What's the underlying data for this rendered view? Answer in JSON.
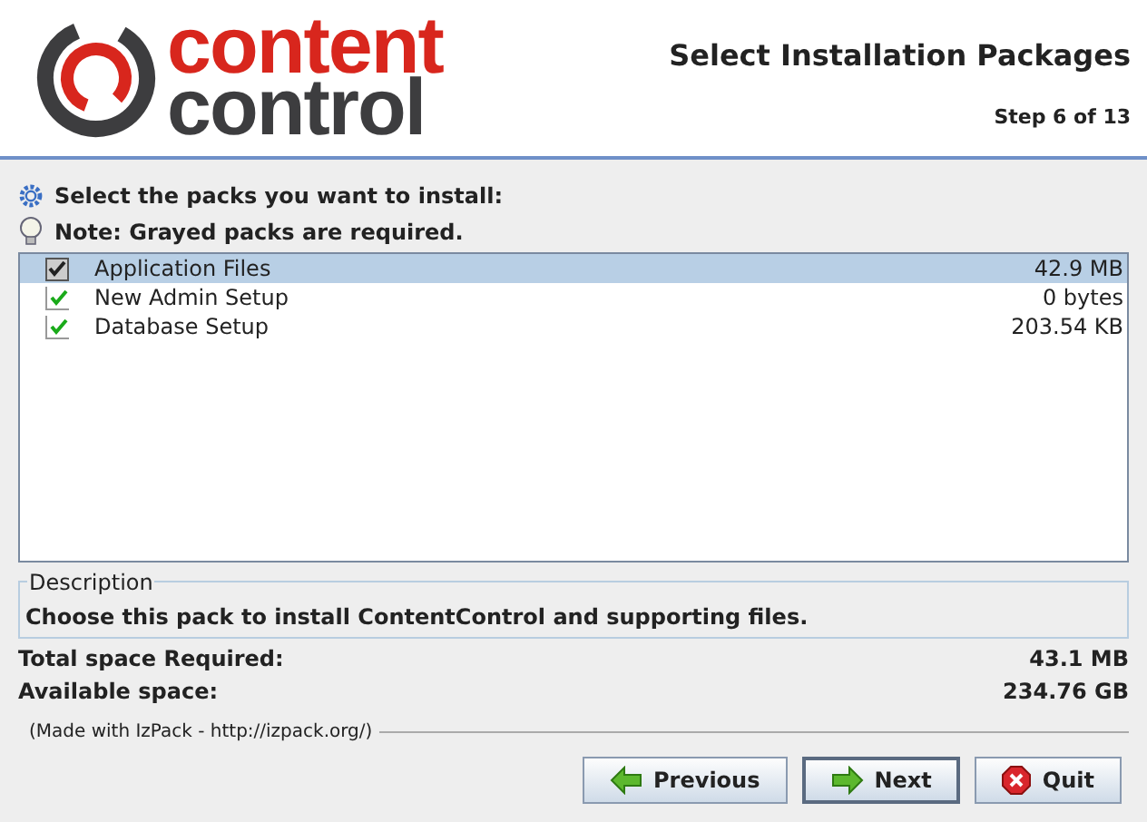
{
  "logo": {
    "line_1": "content",
    "line_2": "control"
  },
  "header": {
    "title": "Select Installation Packages",
    "step": "Step 6 of 13"
  },
  "instructions": [
    {
      "kind": "gear",
      "text": "Select the packs you want to install:"
    },
    {
      "kind": "bulb",
      "text": "Note: Grayed packs are required."
    }
  ],
  "packs": [
    {
      "name": "Application Files",
      "size": "42.9 MB",
      "checked": true,
      "disabled": true,
      "selected": true
    },
    {
      "name": "New Admin Setup",
      "size": "0 bytes",
      "checked": true,
      "disabled": false,
      "selected": false
    },
    {
      "name": "Database Setup",
      "size": "203.54 KB",
      "checked": true,
      "disabled": false,
      "selected": false
    }
  ],
  "description": {
    "legend": "Description",
    "text": "Choose this pack to install ContentControl and supporting files."
  },
  "space": [
    {
      "label": "Total space Required:",
      "value": "43.1 MB"
    },
    {
      "label": "Available space:",
      "value": "234.76 GB"
    }
  ],
  "footer_note": "(Made with IzPack - http://izpack.org/)",
  "buttons": [
    {
      "kind": "previous",
      "label": "Previous"
    },
    {
      "kind": "next",
      "label": "Next"
    },
    {
      "kind": "quit",
      "label": "Quit"
    }
  ]
}
